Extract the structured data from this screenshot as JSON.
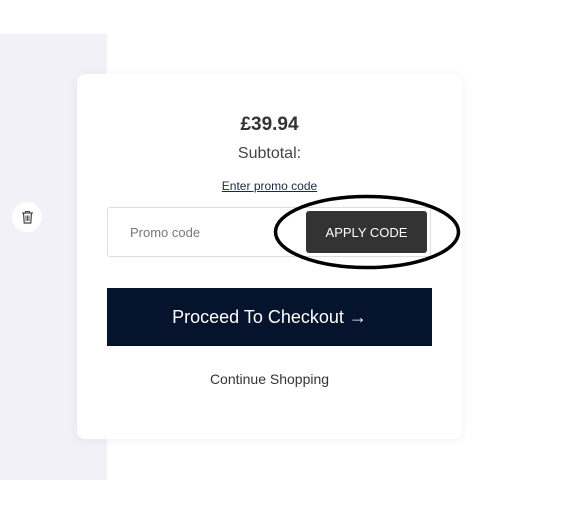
{
  "cart_item": {
    "delete_icon": "trash-icon"
  },
  "summary": {
    "price": "£39.94",
    "subtotal_label": "Subtotal:",
    "promo_link": "Enter promo code",
    "promo_placeholder": "Promo code",
    "promo_value": "",
    "apply_button": "APPLY CODE",
    "checkout_button": "Proceed To Checkout →",
    "continue_link": "Continue Shopping"
  },
  "annotation": {
    "shape": "ellipse",
    "color": "#000000",
    "target": "apply-code-button"
  },
  "colors": {
    "checkout_bg": "#06132c",
    "apply_bg": "#333333",
    "side_panel_bg": "#f2f1f7"
  }
}
